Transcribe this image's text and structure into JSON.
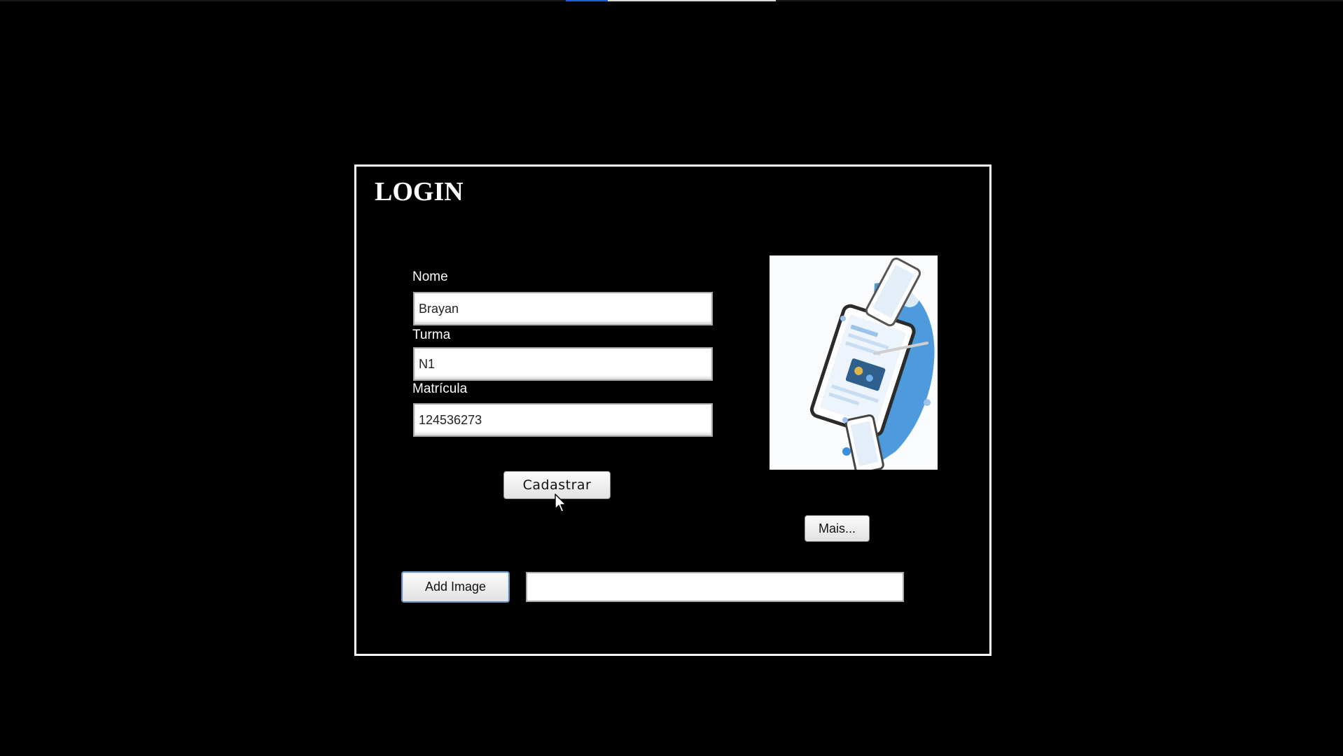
{
  "window": {
    "title": "LOGIN"
  },
  "form": {
    "fields": [
      {
        "label": "Nome",
        "value": "Brayan"
      },
      {
        "label": "Turma",
        "value": "N1"
      },
      {
        "label": "Matrícula",
        "value": "124536273"
      }
    ],
    "submit_label": "Cadastrar"
  },
  "image_panel": {
    "icon": "devices-illustration-icon",
    "more_label": "Mais..."
  },
  "image_picker": {
    "button_label": "Add Image",
    "path_value": ""
  },
  "colors": {
    "background": "#000000",
    "panel_border": "#ffffff",
    "text": "#ffffff",
    "accent_blue": "#3a8fd8"
  }
}
